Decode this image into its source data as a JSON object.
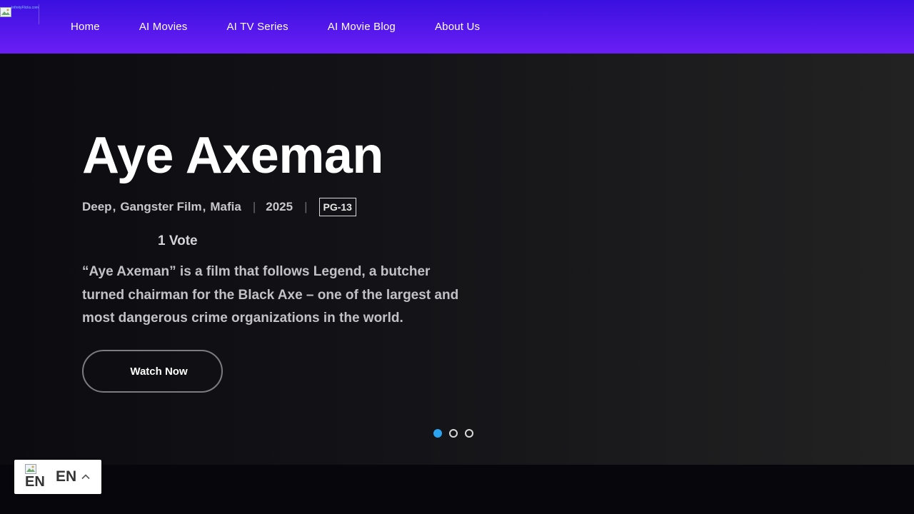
{
  "header": {
    "logo_text": "InfinityFlicks.com",
    "nav": [
      "Home",
      "AI Movies",
      "AI TV Series",
      "AI Movie Blog",
      "About Us"
    ]
  },
  "hero": {
    "title": "Aye Axeman",
    "genres": [
      "Deep",
      "Gangster Film",
      "Mafia"
    ],
    "year": "2025",
    "rating": "PG-13",
    "votes": "1 Vote",
    "description": "“Aye Axeman” is a film that follows Legend, a butcher turned chairman for the Black Axe – one of the largest and most dangerous crime organizations in the world.",
    "watch_label": "Watch Now"
  },
  "slider": {
    "count": 3,
    "active": 1,
    "active_color": "#2aa4f0"
  },
  "language": {
    "flag_alt": "EN",
    "code": "EN"
  },
  "colors": {
    "nav_top": "#3a10e0",
    "nav_bottom": "#6a1ef5",
    "background": "#07060d"
  }
}
